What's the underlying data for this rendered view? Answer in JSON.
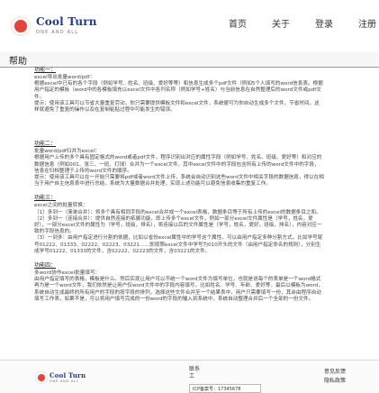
{
  "header": {
    "logo_title": "Cool Turn",
    "logo_sub": "ONE AND ALL",
    "nav": [
      "首页",
      "关于",
      "登录",
      "注册"
    ]
  },
  "help": {
    "title": "帮助"
  },
  "sections": [
    {
      "title": "功能一：",
      "body": "excel导出批量word/pdf：\n根据excel中已有的各个字段（例如学号、姓名、班级、爱好等等）和信息生成多个pdf文件（例如5个人填写的word信息表。根据用户指定的模板（word中的各模板填充以excel文件中各列名称（例如学号+姓名）与当前信息在自然整理后的word文件或pdf文件。\n提示：使用该工具可以节省大量重复劳动，你只需要提供模板文件和excel文件，系统便可为你自动生成多个文件，节省时间。这样就避免了重复的操作以及在复制粘贴过程中可能发生的错误。"
    },
    {
      "title": "功能二：",
      "body": "批量word/pdf归并为excel：\n根据用户上传的多个具有固定格式的word或者pdf文件，程序识别出对应的属性字段（例如学号、姓名、班级、爱好等）和对应的数据信息（例如001、张三、一班、打球）合并为一个excel文件，其中excel文件中的字段包含所有上传的word文件中的字段，信息在归档整理于上传的word文件的顺序。\n提示：使用该工具可以在一开始只需要将pdf或者word文件上传，系统会自动识别这些word文件中相关字段的数据信息，得以在相当于用户自主信息表中进行总结，系统为大量数据合并处理，实现上述功能可以避免信息收集的重复工作。"
    },
    {
      "title": "功能三：",
      "body": "excel之间的批量转换：\n（1）多到一（简单合并）：将多个具有相同字段的excel合并成一个excel表格，数据条目等于所有上传的excel的数据条目之和。\n（2）多到一（连接合并）：提供自然连接的拓展功能，即上传多个excel文件，例如一部分excel文件属性是（学号，姓名，爱好），一部分excel文件的属性为（学号，班级，排名），将连接以后的文件属性是（学号，姓名，爱好，班级，排名），内容对应一致的字段信息的。\n（3）一到多：由用户指定进行分割的依据，比如以省份excel属性中的学号这个属性，可以由用户指定多种分割方式，比如学号尾号01222、01333、02222、02223、03221……即按照excel文件中学号为010开头的文件（由用户指定命名的规则），分别生成学号01222、01333的文件，含02222、02223的文件，含03221的文件。"
    },
    {
      "title": "功能四：",
      "body": "多word协作excel批量填写：\n由用户指定填写的表格，模板是什么。然后实现让用户可以不统一个word文件为填写单位，也就是说每个的表单是一个word格式再为是一个word文件，我们依然是让用户仅word文件中的字段内容填写，比如姓名、学号、年龄、爱好等，最后以模板为word，系统自动生成最终的所有用户的字段的按字段的排列，选择这些文件合并至一个结果表中，用户只需要填写一份，其余由程序自动填写工作表，如果不是，可以将用户填写完成的一份word的字段的输入到系统中，系统自动整理合并后一个全部的一份文件。"
    }
  ],
  "footer": {
    "logo_title": "Cool Turn",
    "logo_sub": "ONE AND ALL",
    "center_line1": "联系",
    "center_line2": "工",
    "icp_label": "ICP备案号：17345678",
    "links": [
      "意见反馈",
      "隐私政策"
    ]
  }
}
